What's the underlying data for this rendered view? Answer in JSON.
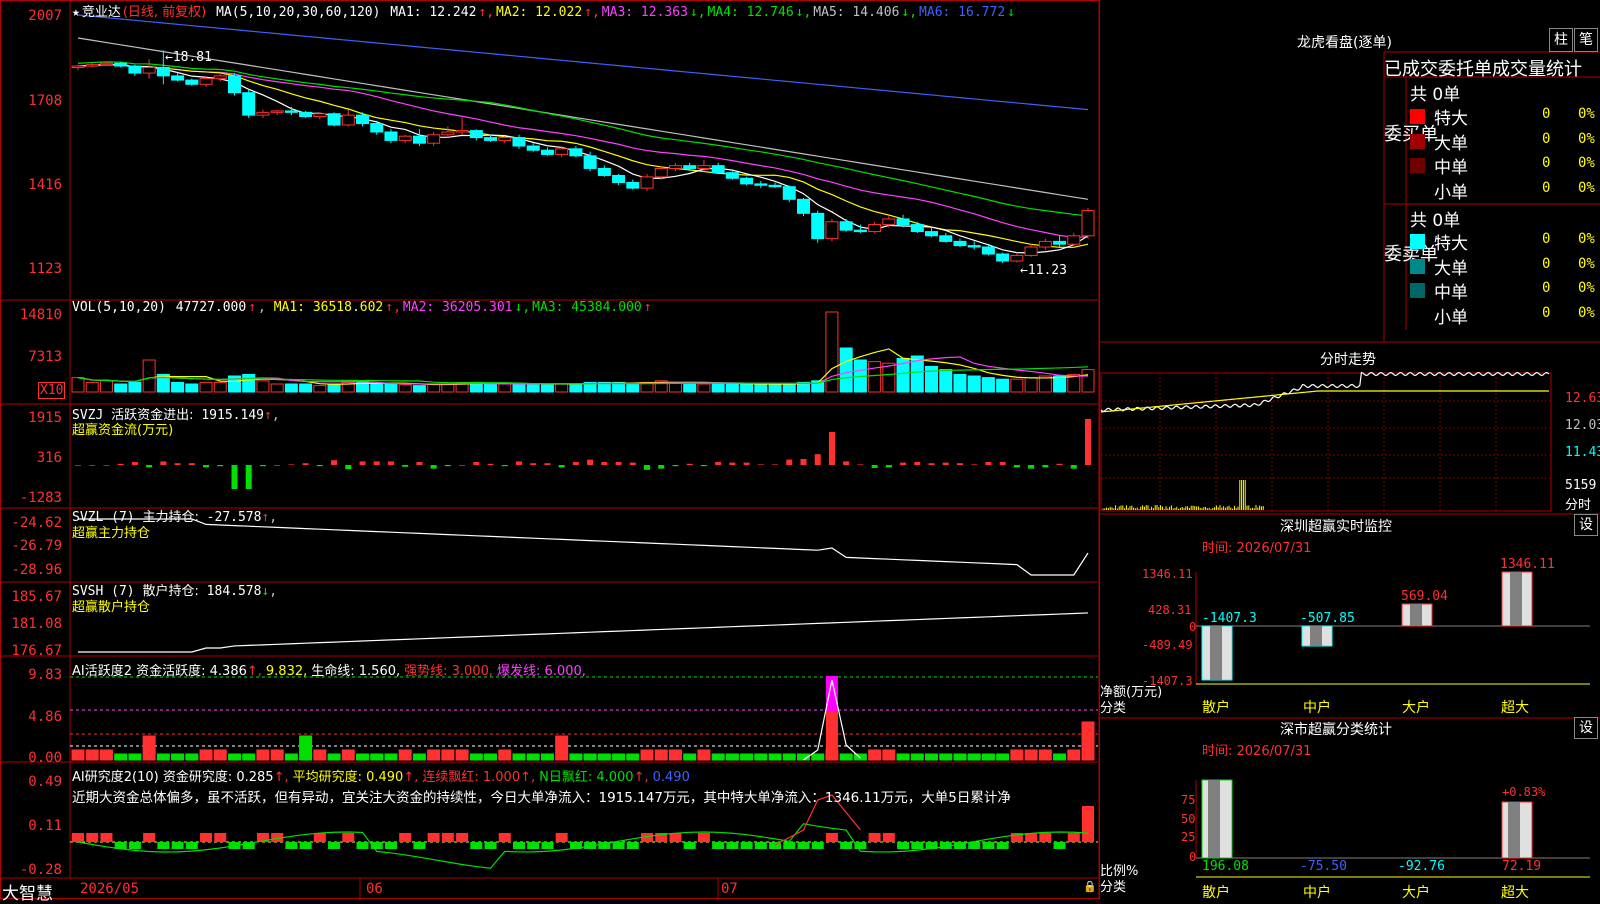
{
  "main": {
    "title": "竞业达",
    "period": "(日线, 前复权)",
    "ma_label": "MA(5,10,20,30,60,120)",
    "ma": [
      {
        "name": "MA1:",
        "value": "12.242",
        "arrow": "↑",
        "color": "#ffffff"
      },
      {
        "name": "MA2:",
        "value": "12.022",
        "arrow": "↑",
        "color": "#ffff00"
      },
      {
        "name": "MA3:",
        "value": "12.363",
        "arrow": "↓",
        "color": "#ff40ff"
      },
      {
        "name": "MA4:",
        "value": "12.746",
        "arrow": "↓",
        "color": "#00e000"
      },
      {
        "name": "MA5:",
        "value": "14.406",
        "arrow": "↓",
        "color": "#c0c0c0"
      },
      {
        "name": "MA6:",
        "value": "16.772",
        "arrow": "↓",
        "color": "#4060ff"
      }
    ],
    "high_mark": "←18.81",
    "low_mark": "←11.23",
    "yticks": [
      "2007",
      "1708",
      "1416",
      "1123"
    ]
  },
  "vol": {
    "label": "VOL(5,10,20)",
    "value": "47727.000",
    "ma": [
      {
        "name": "MA1:",
        "value": "36518.602",
        "arrow": "↑",
        "color": "#ffff00"
      },
      {
        "name": "MA2:",
        "value": "36205.301",
        "arrow": "↓",
        "color": "#ff40ff"
      },
      {
        "name": "MA3:",
        "value": "45384.000",
        "arrow": "↑",
        "color": "#00e000"
      }
    ],
    "yticks": [
      "14810",
      "7313"
    ],
    "unit": "X10"
  },
  "svzj": {
    "label": "SVZJ",
    "title": "活跃资金进出:",
    "value": "1915.149",
    "arrow": "↑",
    "sub": "超赢资金流(万元)",
    "yticks": [
      "1915",
      "316",
      "-1283"
    ]
  },
  "svzl": {
    "label": "SVZL (7)",
    "title": "主力持仓:",
    "value": "-27.578",
    "arrow": "↑",
    "sub": "超赢主力持仓",
    "yticks": [
      "-24.62",
      "-26.79",
      "-28.96"
    ]
  },
  "svsh": {
    "label": "SVSH (7)",
    "title": "散户持仓:",
    "value": "184.578",
    "arrow": "↓",
    "sub": "超赢散户持仓",
    "yticks": [
      "185.67",
      "181.08",
      "176.67"
    ]
  },
  "ai1": {
    "label": "AI活跃度2",
    "items": [
      {
        "text": "资金活跃度: 4.386",
        "color": "#ffffff",
        "arrow": "↑"
      },
      {
        "text": "9.832,",
        "color": "#ffff00",
        "arrow": ""
      },
      {
        "text": "生命线: 1.560,",
        "color": "#ffffff",
        "arrow": ""
      },
      {
        "text": "强势线: 3.000,",
        "color": "#ff3030",
        "arrow": ""
      },
      {
        "text": "爆发线: 6.000,",
        "color": "#ff40ff",
        "arrow": ""
      }
    ],
    "yticks": [
      "9.83",
      "4.86",
      "0.00"
    ]
  },
  "ai2": {
    "label": "AI研究度2(10)",
    "items": [
      {
        "text": "资金研究度: 0.285",
        "color": "#ffffff",
        "arrow": "↑"
      },
      {
        "text": "平均研究度: 0.490",
        "color": "#ffff00",
        "arrow": "↑"
      },
      {
        "text": "连续飘红: 1.000",
        "color": "#ff3030",
        "arrow": "↑"
      },
      {
        "text": "N日飘红: 4.000",
        "color": "#00e000",
        "arrow": "↑"
      },
      {
        "text": "0.490",
        "color": "#4060ff",
        "arrow": ""
      }
    ],
    "comment": "近期大资金总体偏多，虽不活跃，但有异动，宜关注大资金的持续性，今日大单净流入：1915.147万元，其中特大单净流入：1346.11万元，大单5日累计净",
    "yticks": [
      "0.49",
      "0.11",
      "-0.28"
    ]
  },
  "xaxis": {
    "brand": "大智慧",
    "dates": [
      "2026/05",
      "06",
      "07"
    ]
  },
  "right": {
    "longhu": "龙虎看盘(逐单)",
    "btn_bar": "柱",
    "btn_pen": "笔",
    "order_title": "已成交委托单成交量统计",
    "buy": {
      "side": "委买单",
      "total": "共 0单",
      "rows": [
        {
          "name": "特大",
          "val": "0",
          "pct": "0%",
          "color": "#ff0000"
        },
        {
          "name": "大单",
          "val": "0",
          "pct": "0%",
          "color": "#a00000"
        },
        {
          "name": "中单",
          "val": "0",
          "pct": "0%",
          "color": "#700000"
        },
        {
          "name": "小单",
          "val": "0",
          "pct": "0%",
          "color": "#000000"
        }
      ]
    },
    "sell": {
      "side": "委卖单",
      "total": "共 0单",
      "rows": [
        {
          "name": "特大",
          "val": "0",
          "pct": "0%",
          "color": "#00ffff"
        },
        {
          "name": "大单",
          "val": "0",
          "pct": "0%",
          "color": "#008888"
        },
        {
          "name": "中单",
          "val": "0",
          "pct": "0%",
          "color": "#006666"
        },
        {
          "name": "小单",
          "val": "0",
          "pct": "0%",
          "color": "#000000"
        }
      ]
    },
    "intraday": {
      "title": "分时走势",
      "prices": [
        "12.63",
        "12.03",
        "11.43"
      ],
      "vol": "5159",
      "vol_unit": "分时"
    },
    "sz_monitor": {
      "title": "深圳超赢实时监控",
      "btn": "设",
      "time": "时间: 2026/07/31",
      "yticks": [
        "1346.11",
        "428.31",
        "0",
        "-489.49",
        "-1407.3"
      ],
      "bars": [
        {
          "cat": "散户",
          "value": "-1407.3"
        },
        {
          "cat": "中户",
          "value": "-507.85"
        },
        {
          "cat": "大户",
          "value": "569.04"
        },
        {
          "cat": "超大",
          "value": "1346.11"
        }
      ],
      "ylabel": "净额(万元)",
      "xlabel": "分类"
    },
    "sz_class": {
      "title": "深市超赢分类统计",
      "btn": "设",
      "time": "时间: 2026/07/31",
      "yticks": [
        "75",
        "50",
        "25",
        "0"
      ],
      "bars": [
        {
          "cat": "散户",
          "value": "196.08"
        },
        {
          "cat": "中户",
          "value": "-75.50"
        },
        {
          "cat": "大户",
          "value": "-92.76"
        },
        {
          "cat": "超大",
          "value": "72.19"
        }
      ],
      "top_label": "+0.83%",
      "ylabel": "比例%",
      "xlabel": "分类"
    }
  },
  "chart_data": {
    "type": "candlestick",
    "candles": [
      [
        18.2,
        18.3,
        18.1,
        18.25
      ],
      [
        18.25,
        18.35,
        18.2,
        18.3
      ],
      [
        18.3,
        18.4,
        18.25,
        18.35
      ],
      [
        18.35,
        18.4,
        18.2,
        18.25
      ],
      [
        18.25,
        18.3,
        17.9,
        18.0
      ],
      [
        18.0,
        18.5,
        17.8,
        18.2
      ],
      [
        18.2,
        18.81,
        17.6,
        17.9
      ],
      [
        17.9,
        18.0,
        17.7,
        17.75
      ],
      [
        17.75,
        17.8,
        17.55,
        17.6
      ],
      [
        17.6,
        17.9,
        17.5,
        17.8
      ],
      [
        17.8,
        18.0,
        17.7,
        17.9
      ],
      [
        17.9,
        18.0,
        17.2,
        17.3
      ],
      [
        17.3,
        17.4,
        16.4,
        16.5
      ],
      [
        16.5,
        16.7,
        16.4,
        16.6
      ],
      [
        16.6,
        16.7,
        16.5,
        16.65
      ],
      [
        16.65,
        16.8,
        16.5,
        16.6
      ],
      [
        16.6,
        16.65,
        16.4,
        16.45
      ],
      [
        16.45,
        16.6,
        16.35,
        16.55
      ],
      [
        16.55,
        16.6,
        16.1,
        16.15
      ],
      [
        16.15,
        16.7,
        16.1,
        16.5
      ],
      [
        16.5,
        16.6,
        16.1,
        16.2
      ],
      [
        16.2,
        16.3,
        15.8,
        15.9
      ],
      [
        15.9,
        16.0,
        15.5,
        15.6
      ],
      [
        15.6,
        15.8,
        15.5,
        15.75
      ],
      [
        15.75,
        16.0,
        15.4,
        15.5
      ],
      [
        15.5,
        15.9,
        15.4,
        15.8
      ],
      [
        15.8,
        16.1,
        15.7,
        15.9
      ],
      [
        15.9,
        16.4,
        15.8,
        15.95
      ],
      [
        15.95,
        16.0,
        15.6,
        15.7
      ],
      [
        15.7,
        15.8,
        15.55,
        15.6
      ],
      [
        15.6,
        15.75,
        15.5,
        15.7
      ],
      [
        15.7,
        15.8,
        15.3,
        15.4
      ],
      [
        15.4,
        15.5,
        15.2,
        15.25
      ],
      [
        15.25,
        15.35,
        15.05,
        15.1
      ],
      [
        15.1,
        15.4,
        15.0,
        15.3
      ],
      [
        15.3,
        15.4,
        15.0,
        15.05
      ],
      [
        15.05,
        15.2,
        14.5,
        14.6
      ],
      [
        14.6,
        14.7,
        14.3,
        14.35
      ],
      [
        14.35,
        14.4,
        14.0,
        14.1
      ],
      [
        14.1,
        14.2,
        13.85,
        13.9
      ],
      [
        13.9,
        14.4,
        13.8,
        14.3
      ],
      [
        14.3,
        14.7,
        14.2,
        14.6
      ],
      [
        14.6,
        14.8,
        14.5,
        14.7
      ],
      [
        14.7,
        14.8,
        14.5,
        14.6
      ],
      [
        14.6,
        14.9,
        14.5,
        14.7
      ],
      [
        14.7,
        14.8,
        14.4,
        14.45
      ],
      [
        14.45,
        14.5,
        14.2,
        14.25
      ],
      [
        14.25,
        14.3,
        14.0,
        14.05
      ],
      [
        14.05,
        14.15,
        13.9,
        14.0
      ],
      [
        14.0,
        14.1,
        13.9,
        13.95
      ],
      [
        13.95,
        14.0,
        13.4,
        13.5
      ],
      [
        13.5,
        13.55,
        12.9,
        13.0
      ],
      [
        13.0,
        13.1,
        11.95,
        12.1
      ],
      [
        12.1,
        12.8,
        12.0,
        12.7
      ],
      [
        12.7,
        12.8,
        12.35,
        12.4
      ],
      [
        12.4,
        12.6,
        12.3,
        12.35
      ],
      [
        12.35,
        12.7,
        12.3,
        12.6
      ],
      [
        12.6,
        12.9,
        12.5,
        12.8
      ],
      [
        12.8,
        12.95,
        12.5,
        12.6
      ],
      [
        12.6,
        12.7,
        12.3,
        12.35
      ],
      [
        12.35,
        12.5,
        12.15,
        12.2
      ],
      [
        12.2,
        12.3,
        11.95,
        12.0
      ],
      [
        12.0,
        12.1,
        11.8,
        11.85
      ],
      [
        11.85,
        12.0,
        11.7,
        11.8
      ],
      [
        11.8,
        11.85,
        11.5,
        11.55
      ],
      [
        11.55,
        11.6,
        11.23,
        11.3
      ],
      [
        11.3,
        11.6,
        11.25,
        11.5
      ],
      [
        11.5,
        11.9,
        11.45,
        11.8
      ],
      [
        11.8,
        12.1,
        11.7,
        12.0
      ],
      [
        12.0,
        12.2,
        11.8,
        11.9
      ],
      [
        11.9,
        12.3,
        11.85,
        12.2
      ],
      [
        12.2,
        13.2,
        12.1,
        13.1
      ]
    ]
  }
}
